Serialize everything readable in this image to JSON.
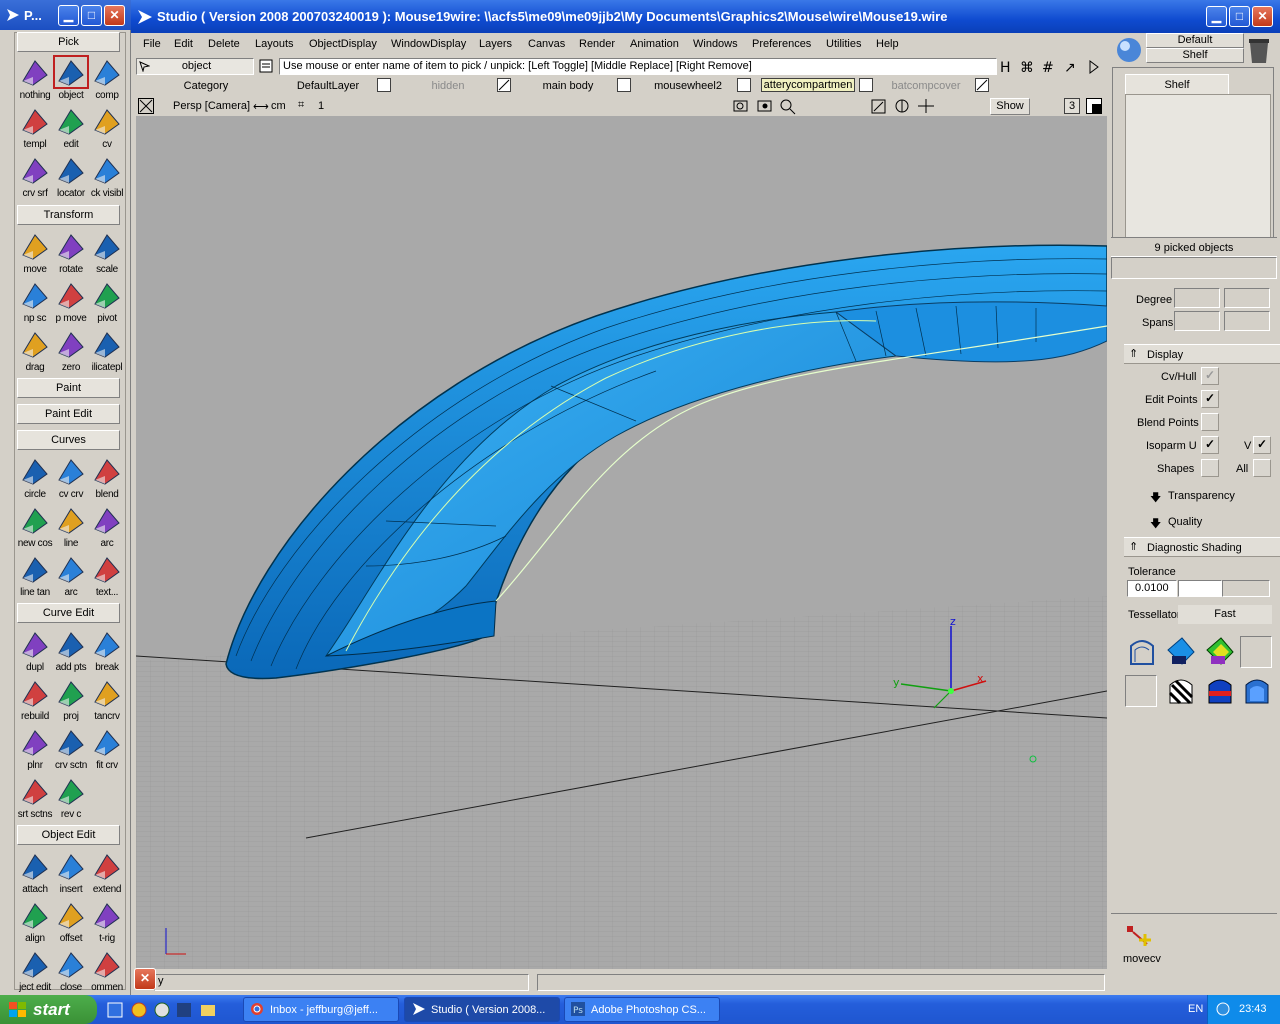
{
  "palette": {
    "title": "P...",
    "sections": {
      "pick": "Pick",
      "transform": "Transform",
      "paint": "Paint",
      "paint_edit": "Paint Edit",
      "curves": "Curves",
      "curve_edit": "Curve Edit",
      "object_edit": "Object Edit"
    },
    "pick_tools": [
      "nothing",
      "object",
      "comp",
      "templ",
      "edit",
      "cv",
      "crv srf",
      "locator",
      "ck visibl"
    ],
    "transform_tools": [
      "move",
      "rotate",
      "scale",
      "np sc",
      "p move",
      "pivot",
      "drag",
      "zero",
      "ilicatepl"
    ],
    "curve_tools": [
      "circle",
      "cv crv",
      "blend",
      "new cos",
      "line",
      "arc",
      "line tan",
      "arc",
      "text..."
    ],
    "curve_edit_tools": [
      "dupl",
      "add pts",
      "break",
      "rebuild",
      "proj",
      "tancrv",
      "plnr",
      "crv sctn",
      "fit crv",
      "srt sctns",
      "rev c"
    ],
    "object_edit_tools": [
      "attach",
      "insert",
      "extend",
      "align",
      "offset",
      "t-rig",
      "ject edit",
      "close",
      "ommen"
    ]
  },
  "window": {
    "title": "Studio ( Version 2008  200703240019 ): Mouse19wire: \\\\acfs5\\me09\\me09jjb2\\My Documents\\Graphics2\\Mouse\\wire\\Mouse19.wire"
  },
  "menu": [
    "File",
    "Edit",
    "Delete",
    "Layouts",
    "ObjectDisplay",
    "WindowDisplay",
    "Layers",
    "Canvas",
    "Render",
    "Animation",
    "Windows",
    "Preferences",
    "Utilities",
    "Help"
  ],
  "pickbar": {
    "mode": "object",
    "prompt": "Use mouse or enter name of item to pick / unpick: [Left Toggle] [Middle Replace] [Right Remove]"
  },
  "layers": {
    "category": "Category",
    "items": [
      "DefaultLayer",
      "hidden",
      "main body",
      "mousewheel2",
      "atterycompartmen",
      "batcompcover"
    ]
  },
  "viewbar": {
    "camera": "Persp [Camera]",
    "units": "cm",
    "count": "1",
    "show": "Show",
    "number": "3"
  },
  "shelf": {
    "default_label": "Default",
    "shelf_label": "Shelf",
    "tab": "Shelf"
  },
  "control": {
    "picked": "9 picked objects",
    "degree": "Degree",
    "spans": "Spans",
    "display": "Display",
    "cvhull": "Cv/Hull",
    "edit_points": "Edit Points",
    "blend_points": "Blend Points",
    "isoparm_u": "Isoparm U",
    "v": "V",
    "shapes": "Shapes",
    "all": "All",
    "transparency": "Transparency",
    "quality": "Quality",
    "diag": "Diagnostic Shading",
    "tolerance": "Tolerance",
    "tol_value": "0.0100",
    "tessellator": "Tessellator",
    "tess_value": "Fast"
  },
  "axes": {
    "z": "z",
    "x": "x",
    "y": "y"
  },
  "recent_tool": "movecv",
  "status_char": "y",
  "taskbar": {
    "start": "start",
    "tasks": [
      "Inbox - jeffburg@jeff...",
      "Studio ( Version 2008...",
      "Adobe Photoshop CS..."
    ],
    "lang": "EN",
    "clock": "23:43"
  },
  "colors": {
    "title_blue": "#0f4bd0",
    "surface_blue": "#1e90e0",
    "viewport_gray": "#a9a9a9",
    "start_green": "#3a9136"
  }
}
